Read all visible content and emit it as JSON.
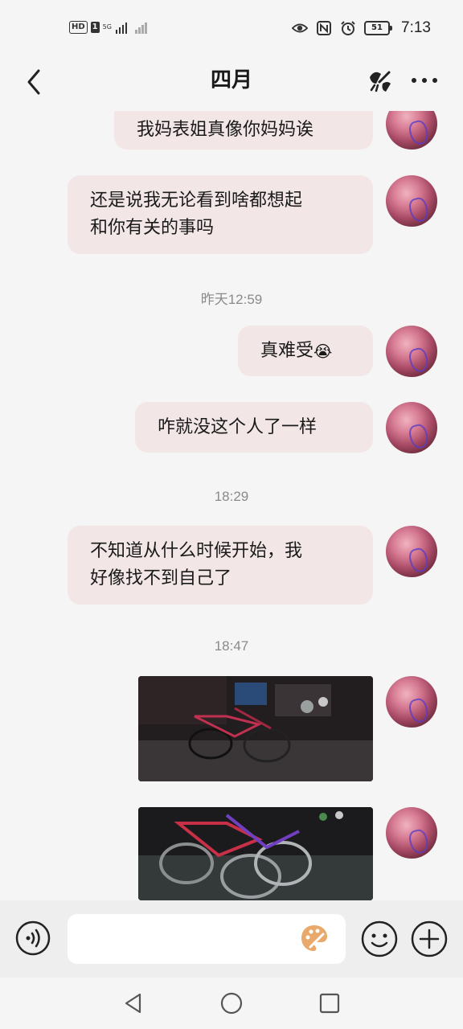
{
  "status_bar": {
    "hd_label": "HD",
    "sim_label": "1",
    "network_label": "5G",
    "battery": "51",
    "time": "7:13"
  },
  "header": {
    "title": "四月",
    "back_icon": "chevron-left-icon",
    "tool_icon": "broom-icon",
    "more_icon": "more-dots-icon"
  },
  "messages": [
    {
      "text": "我妈表姐真像你妈妈诶"
    },
    {
      "text_line1": "还是说我无论看到啥都想起",
      "text_line2": "和你有关的事吗"
    },
    {
      "text": "真难受",
      "emoji": "😭"
    },
    {
      "text": "咋就没这个人了一样"
    },
    {
      "text_line1": "不知道从什么时候开始，我",
      "text_line2": "好像找不到自己了"
    }
  ],
  "timestamps": [
    "昨天12:59",
    "18:29",
    "18:47"
  ],
  "input_bar": {
    "placeholder": "",
    "voice_icon": "voice-icon",
    "palette_icon": "palette-icon",
    "emoji_icon": "smiley-icon",
    "plus_icon": "plus-circle-icon"
  },
  "colors": {
    "bubble": "#f2e6e6",
    "background": "#f5f5f5",
    "timestamp": "#8a8a8a",
    "palette": "#e8a96a"
  }
}
